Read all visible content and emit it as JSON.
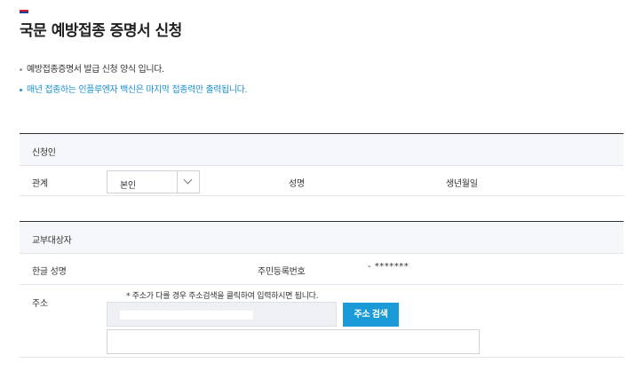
{
  "page": {
    "title": "국문 예방접종 증명서 신청"
  },
  "notices": [
    "예방접종증명서 발급 신청 양식 입니다.",
    "매년 접종하는 인플루엔자 백신은 마지막 접종력만 출력됩니다."
  ],
  "applicant": {
    "section_label": "신청인",
    "relation_label": "관계",
    "relation_value": "본인",
    "name_label": "성명",
    "birth_label": "생년월일"
  },
  "recipient": {
    "section_label": "교부대상자",
    "korean_name_label": "한글 성명",
    "rrn_label": "주민등록번호",
    "rrn_value": "- *******",
    "address_label": "주소",
    "address_note": "* 주소가 다를 경우 주소검색을 클릭하여 입력하시면 됩니다.",
    "address_search_label": "주소 검색"
  },
  "colors": {
    "accent_blue": "#1a9bd7",
    "notice_blue": "#1b8fcd",
    "flag_red": "#d11d2e",
    "flag_blue": "#1b3e8f"
  }
}
